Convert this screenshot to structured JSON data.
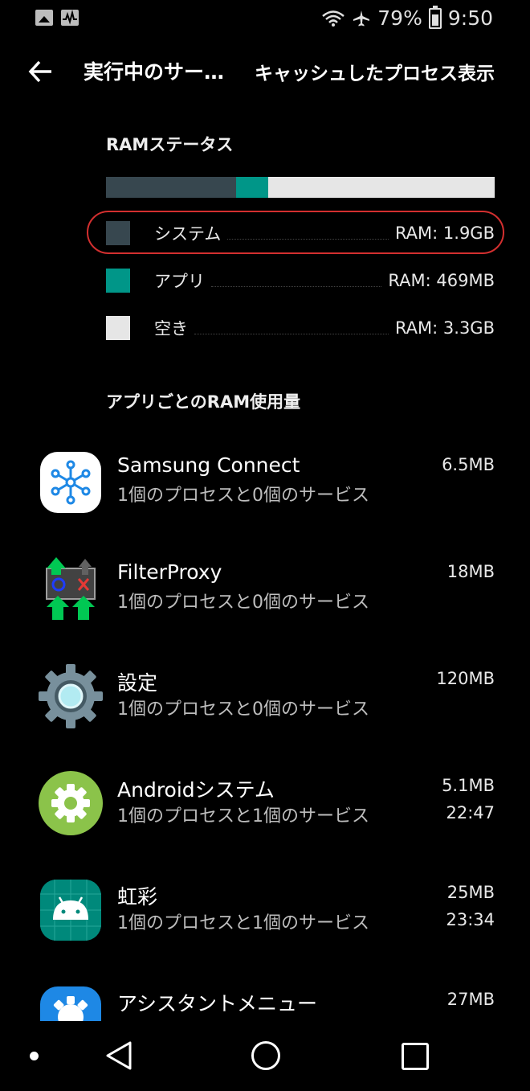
{
  "status_bar": {
    "battery": "79%",
    "time": "9:50"
  },
  "app_bar": {
    "title": "実行中のサー…",
    "action": "キャッシュしたプロセス表示"
  },
  "ram_status": {
    "title": "RAMステータス",
    "bar_fractions": {
      "system": 0.335,
      "app": 0.082,
      "free": 0.583
    },
    "items": [
      {
        "label": "システム",
        "value": "RAM: 1.9GB",
        "color": "#37474f"
      },
      {
        "label": "アプリ",
        "value": "RAM: 469MB",
        "color": "#009688"
      },
      {
        "label": "空き",
        "value": "RAM: 3.3GB",
        "color": "#e6e6e6"
      }
    ]
  },
  "per_app": {
    "title": "アプリごとのRAM使用量",
    "apps": [
      {
        "name": "Samsung Connect",
        "detail": "1個のプロセスと0個のサービス",
        "size": "6.5MB",
        "time": "",
        "icon": "samsung-connect-icon"
      },
      {
        "name": "FilterProxy",
        "detail": "1個のプロセスと0個のサービス",
        "size": "18MB",
        "time": "",
        "icon": "filterproxy-icon"
      },
      {
        "name": "設定",
        "detail": "1個のプロセスと0個のサービス",
        "size": "120MB",
        "time": "",
        "icon": "settings-icon"
      },
      {
        "name": "Androidシステム",
        "detail": "1個のプロセスと1個のサービス",
        "size": "5.1MB",
        "time": "22:47",
        "icon": "android-system-icon"
      },
      {
        "name": "虹彩",
        "detail": "1個のプロセスと1個のサービス",
        "size": "25MB",
        "time": "23:34",
        "icon": "android-icon"
      },
      {
        "name": "アシスタントメニュー",
        "detail": "",
        "size": "27MB",
        "time": "",
        "icon": "assistant-menu-icon"
      }
    ]
  },
  "colors": {
    "highlight": "#d32f2f",
    "accent": "#009688"
  }
}
